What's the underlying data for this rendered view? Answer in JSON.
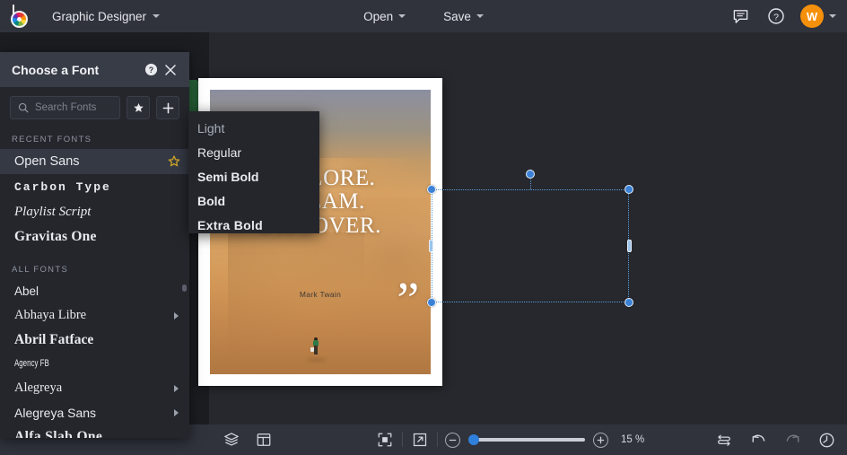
{
  "app": {
    "logo_icon": "color-wheel-logo-icon",
    "document_title": "Graphic Designer"
  },
  "topbar": {
    "open_label": "Open",
    "save_label": "Save",
    "comment_icon": "comment-icon",
    "help_icon": "question-circle-icon",
    "avatar_initial": "W",
    "avatar_color": "#f5900c",
    "caret_icon": "chevron-down-icon"
  },
  "font_panel": {
    "title": "Choose a Font",
    "help_icon": "help-circle-icon",
    "close_icon": "close-icon",
    "search": {
      "placeholder": "Search Fonts",
      "icon": "search-icon"
    },
    "favorites_button_icon": "star-icon",
    "add_button_icon": "plus-icon",
    "recent_label": "RECENT FONTS",
    "recent_fonts": [
      {
        "name": "Open Sans",
        "style": "f-opensans",
        "selected": true,
        "starred": true,
        "has_submenu": false
      },
      {
        "name": "Carbon Type",
        "style": "f-carbon",
        "selected": false,
        "starred": false,
        "has_submenu": false
      },
      {
        "name": "Playlist Script",
        "style": "f-playlist",
        "selected": false,
        "starred": false,
        "has_submenu": false
      },
      {
        "name": "Gravitas One",
        "style": "f-gravitas",
        "selected": false,
        "starred": false,
        "has_submenu": false
      }
    ],
    "all_label": "ALL FONTS",
    "all_fonts": [
      {
        "name": "Abel",
        "style": "f-abel",
        "has_submenu": false
      },
      {
        "name": "Abhaya Libre",
        "style": "f-abhaya",
        "has_submenu": true
      },
      {
        "name": "Abril Fatface",
        "style": "f-abril",
        "has_submenu": false
      },
      {
        "name": "Agency FB",
        "style": "f-agency",
        "has_submenu": false
      },
      {
        "name": "Alegreya",
        "style": "f-alegreya",
        "has_submenu": true
      },
      {
        "name": "Alegreya Sans",
        "style": "f-alegreyas",
        "has_submenu": true
      },
      {
        "name": "Alfa Slab One",
        "style": "f-alfa",
        "has_submenu": false
      }
    ],
    "star_color": "#c9a227"
  },
  "weight_submenu": {
    "items": [
      {
        "label": "Light",
        "style": "w-light"
      },
      {
        "label": "Regular",
        "style": "w-reg"
      },
      {
        "label": "Semi Bold",
        "style": "w-semi"
      },
      {
        "label": "Bold",
        "style": "w-bold"
      },
      {
        "label": "Extra Bold",
        "style": "w-xbold"
      }
    ]
  },
  "canvas": {
    "poster": {
      "open_quote": "“",
      "close_quote": "”",
      "quote_line1": "EXPLORE.",
      "quote_line2": "DREAM.",
      "quote_line3": "DISCOVER.",
      "attribution": "Mark Twain"
    },
    "selection": {
      "handle_color": "#3b82d6",
      "border_color": "#5a9bd8"
    }
  },
  "bottombar": {
    "layers_icon": "layers-icon",
    "pages_icon": "layout-grid-icon",
    "fit_icon": "fit-to-screen-icon",
    "fullscreen_icon": "expand-arrow-icon",
    "zoom_out_icon": "minus-icon",
    "zoom_in_icon": "plus-icon",
    "zoom_value": "15 %",
    "swap_icon": "swap-arrows-icon",
    "undo_icon": "undo-icon",
    "redo_icon": "redo-icon",
    "history_icon": "clock-history-icon"
  }
}
